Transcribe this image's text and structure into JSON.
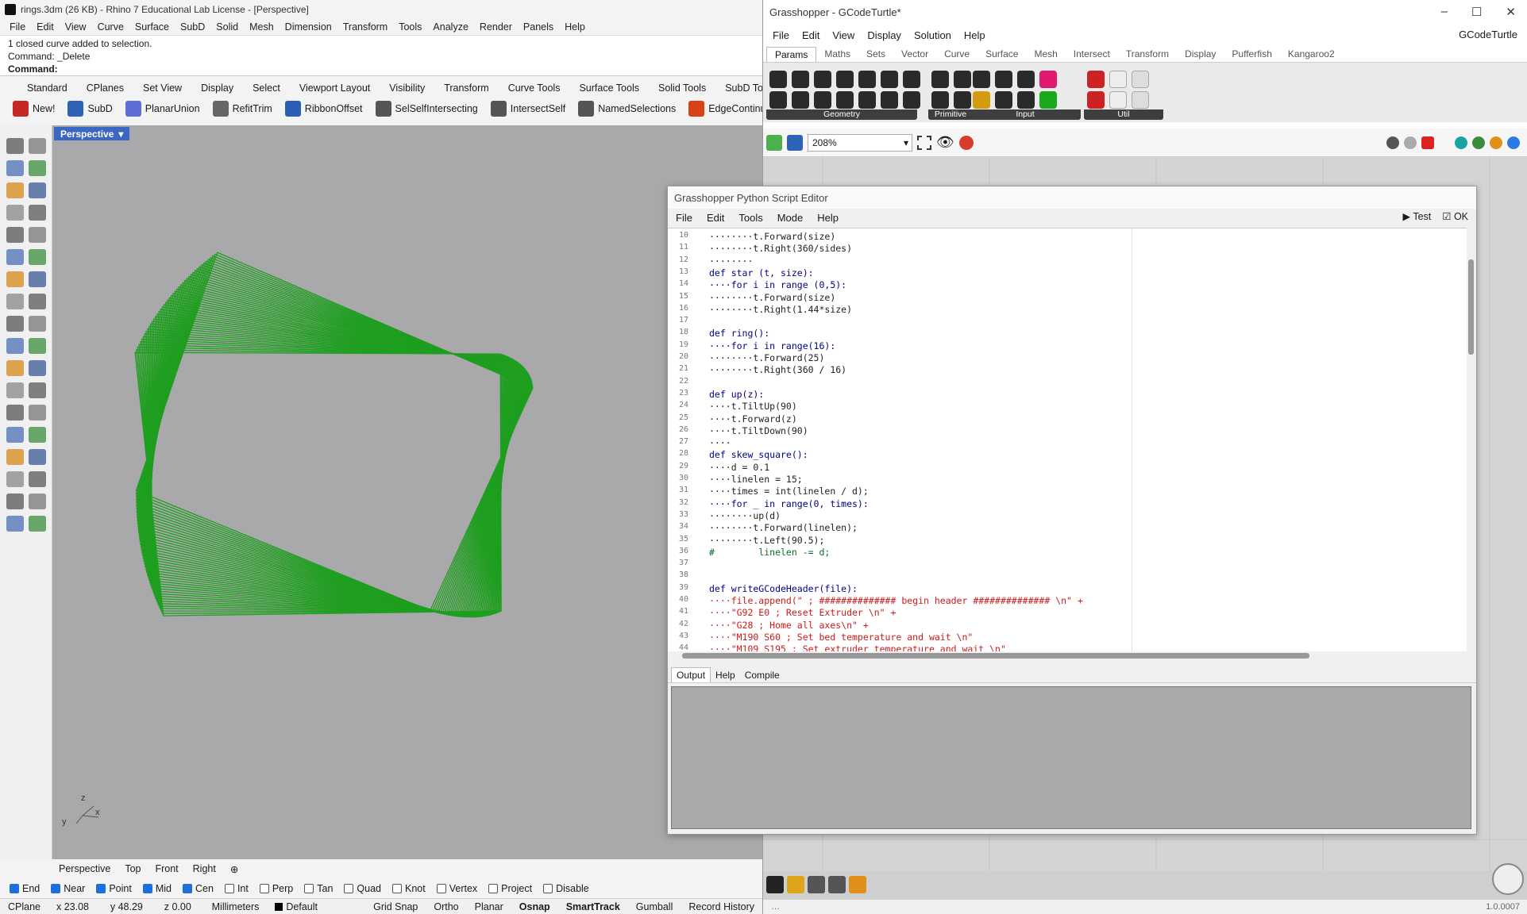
{
  "rhino": {
    "title": "rings.3dm (26 KB) - Rhino 7 Educational Lab License - [Perspective]",
    "menu": [
      "File",
      "Edit",
      "View",
      "Curve",
      "Surface",
      "SubD",
      "Solid",
      "Mesh",
      "Dimension",
      "Transform",
      "Tools",
      "Analyze",
      "Render",
      "Panels",
      "Help"
    ],
    "command_history": [
      "1 closed curve added to selection.",
      "Command: _Delete"
    ],
    "command_prompt": "Command:",
    "tabs": [
      "Standard",
      "CPlanes",
      "Set View",
      "Display",
      "Select",
      "Viewport Layout",
      "Visibility",
      "Transform",
      "Curve Tools",
      "Surface Tools",
      "Solid Tools",
      "SubD Tools"
    ],
    "toolbar": [
      "New!",
      "SubD",
      "PlanarUnion",
      "RefitTrim",
      "RibbonOffset",
      "SelSelfIntersecting",
      "IntersectSelf",
      "NamedSelections",
      "EdgeContinuity"
    ],
    "viewport_label": "Perspective",
    "viewport_tabs": [
      "Perspective",
      "Top",
      "Front",
      "Right"
    ],
    "axis": {
      "x": "x",
      "y": "y",
      "z": "z"
    },
    "snaps": [
      {
        "label": "End",
        "on": true
      },
      {
        "label": "Near",
        "on": true
      },
      {
        "label": "Point",
        "on": true
      },
      {
        "label": "Mid",
        "on": true
      },
      {
        "label": "Cen",
        "on": true
      },
      {
        "label": "Int",
        "on": false
      },
      {
        "label": "Perp",
        "on": false
      },
      {
        "label": "Tan",
        "on": false
      },
      {
        "label": "Quad",
        "on": false
      },
      {
        "label": "Knot",
        "on": false
      },
      {
        "label": "Vertex",
        "on": false
      },
      {
        "label": "Project",
        "on": false
      },
      {
        "label": "Disable",
        "on": false
      }
    ],
    "status": {
      "cplane": "CPlane",
      "x": "x 23.08",
      "y": "y 48.29",
      "z": "z 0.00",
      "units": "Millimeters",
      "layer": "Default",
      "toggles": [
        "Grid Snap",
        "Ortho",
        "Planar",
        "Osnap",
        "SmartTrack",
        "Gumball",
        "Record History"
      ]
    }
  },
  "gh": {
    "title": "Grasshopper - GCodeTurtle*",
    "menu": [
      "File",
      "Edit",
      "View",
      "Display",
      "Solution",
      "Help"
    ],
    "doc_name": "GCodeTurtle",
    "tabs": [
      "Params",
      "Maths",
      "Sets",
      "Vector",
      "Curve",
      "Surface",
      "Mesh",
      "Intersect",
      "Transform",
      "Display",
      "Pufferfish",
      "Kangaroo2"
    ],
    "groups": [
      "Geometry",
      "Primitive",
      "Input",
      "Util"
    ],
    "zoom": "208%",
    "version": "1.0.0007"
  },
  "editor": {
    "title": "Grasshopper Python Script Editor",
    "menu": [
      "File",
      "Edit",
      "Tools",
      "Mode",
      "Help"
    ],
    "test": "Test",
    "ok": "OK",
    "output_tabs": [
      "Output",
      "Help",
      "Compile"
    ],
    "lines": [
      {
        "n": "10",
        "t": "········t.Forward(size)"
      },
      {
        "n": "11",
        "t": "········t.Right(360/sides)"
      },
      {
        "n": "12",
        "t": "········"
      },
      {
        "n": "13",
        "t": "def star (t, size):"
      },
      {
        "n": "14",
        "t": "····for i in range (0,5):"
      },
      {
        "n": "15",
        "t": "········t.Forward(size)"
      },
      {
        "n": "16",
        "t": "········t.Right(1.44*size)"
      },
      {
        "n": "17",
        "t": ""
      },
      {
        "n": "18",
        "t": "def ring():"
      },
      {
        "n": "19",
        "t": "····for i in range(16):"
      },
      {
        "n": "20",
        "t": "········t.Forward(25)"
      },
      {
        "n": "21",
        "t": "········t.Right(360 / 16)"
      },
      {
        "n": "22",
        "t": ""
      },
      {
        "n": "23",
        "t": "def up(z):"
      },
      {
        "n": "24",
        "t": "····t.TiltUp(90)"
      },
      {
        "n": "25",
        "t": "····t.Forward(z)"
      },
      {
        "n": "26",
        "t": "····t.TiltDown(90)"
      },
      {
        "n": "27",
        "t": "····"
      },
      {
        "n": "28",
        "t": "def skew_square():"
      },
      {
        "n": "29",
        "t": "····d = 0.1"
      },
      {
        "n": "30",
        "t": "····linelen = 15;"
      },
      {
        "n": "31",
        "t": "····times = int(linelen / d);"
      },
      {
        "n": "32",
        "t": "····for _ in range(0, times):"
      },
      {
        "n": "33",
        "t": "········up(d)"
      },
      {
        "n": "34",
        "t": "········t.Forward(linelen);"
      },
      {
        "n": "35",
        "t": "········t.Left(90.5);"
      },
      {
        "n": "36",
        "t": "#        linelen -= d;"
      },
      {
        "n": "37",
        "t": ""
      },
      {
        "n": "38",
        "t": ""
      },
      {
        "n": "39",
        "t": "def writeGCodeHeader(file):"
      },
      {
        "n": "40",
        "t": "····file.append(\" ; ############## begin header ############## \\n\" +"
      },
      {
        "n": "41",
        "t": "····\"G92 E0 ; Reset Extruder \\n\" +"
      },
      {
        "n": "42",
        "t": "····\"G28 ; Home all axes\\n\" +"
      },
      {
        "n": "43",
        "t": "····\"M190 S60 ; Set bed temperature and wait \\n\""
      },
      {
        "n": "44",
        "t": "····\"M109 S195 ; Set extruder temperature and wait \\n\""
      }
    ]
  },
  "colors": {
    "curve": "#1f9e1f",
    "viewport": "#a9a9ab",
    "vp_label": "#3a66c4",
    "keyword": "#00008b",
    "string": "#d01919"
  }
}
